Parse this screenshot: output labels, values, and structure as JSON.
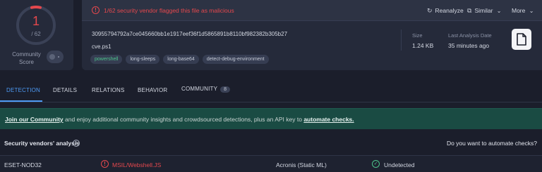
{
  "score": {
    "detections": "1",
    "total": "/ 62",
    "community_label": "Community Score",
    "ring_color": "#e5484d"
  },
  "alert": {
    "icon": "exclamation-circle-icon",
    "text": "1/62 security vendor flagged this file as malicious"
  },
  "actions": {
    "reanalyze": "Reanalyze",
    "similar": "Similar",
    "more": "More"
  },
  "file": {
    "hash": "30955794792a7ce045660bb1e1917eef36f1d5865891b8110bf982382b305b27",
    "name": "cve.ps1",
    "tags": [
      "powershell",
      "long-sleeps",
      "long-base64",
      "detect-debug-environment"
    ],
    "size_label": "Size",
    "size_value": "1.24 KB",
    "date_label": "Last Analysis Date",
    "date_value": "35 minutes ago",
    "type_icon": "document-icon"
  },
  "tabs": {
    "detection": "DETECTION",
    "details": "DETAILS",
    "relations": "RELATIONS",
    "behavior": "BEHAVIOR",
    "community": "COMMUNITY",
    "community_count": "8"
  },
  "banner": {
    "link1": "Join our Community",
    "middle": " and enjoy additional community insights and crowdsourced detections, plus an API key to ",
    "link2": "automate checks."
  },
  "vendors": {
    "title": "Security vendors' analysis",
    "automate_question": "Do you want to automate checks?",
    "rows": [
      {
        "vendor1": "ESET-NOD32",
        "result1": "MSIL/Webshell.JS",
        "vendor2": "Acronis (Static ML)",
        "result2": "Undetected"
      }
    ]
  },
  "colors": {
    "malicious": "#e5484d",
    "clean": "#4cc38a",
    "accent": "#4e9bf5",
    "banner": "#1a4b43"
  }
}
